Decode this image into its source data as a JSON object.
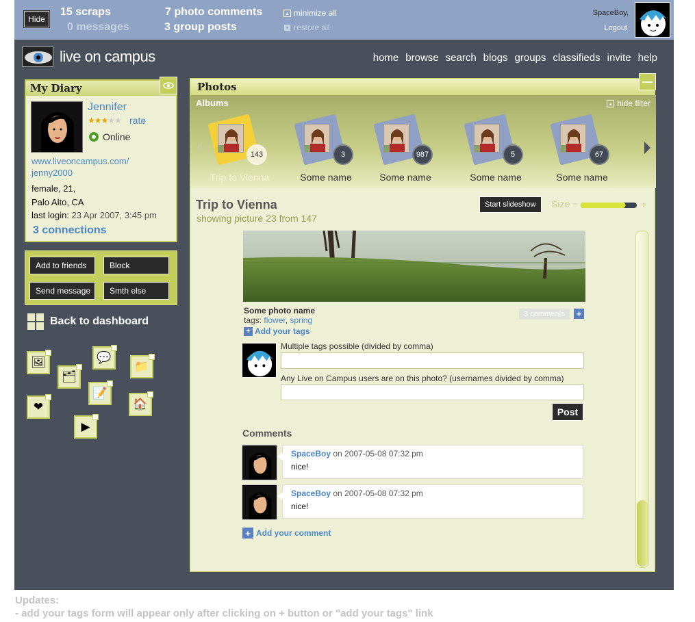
{
  "topbar": {
    "hide_label": "Hide",
    "scraps": "15 scraps",
    "messages": "0 messages",
    "photo_comments": "7 photo comments",
    "group_posts": "3 group posts",
    "minimize_all": "minimize all",
    "restore_all": "restore all",
    "user_name": "SpaceBoy,",
    "logout": "Logout"
  },
  "brand": {
    "logo_text": "live on campus"
  },
  "nav": [
    "home",
    "browse",
    "search",
    "blogs",
    "groups",
    "classifieds",
    "invite",
    "help"
  ],
  "diary": {
    "title": "My Diary",
    "name": "Jennifer",
    "stars_on": "★★★",
    "stars_off": "★★",
    "rating": 3,
    "rate_label": "rate",
    "status": "Online",
    "url_line1": "www.liveoncampus.com/",
    "url_line2": "jenny2000",
    "gender_age": "female, 21,",
    "location": "Palo Alto, CA",
    "last_login_label": "last login:",
    "last_login_value": "23 Apr 2007, 3:45 pm",
    "connections": "3 connections"
  },
  "actions": {
    "add_friends": "Add to friends",
    "block": "Block",
    "send_message": "Send message",
    "something_else": "Smth else"
  },
  "back_to_dashboard": "Back to dashboard",
  "app_icons": [
    "photo-frame-icon",
    "chat-bubbles-icon",
    "folder-icon",
    "photo-album-icon",
    "notepad-icon",
    "heart-icon",
    "house-icon",
    "media-play-icon"
  ],
  "photos": {
    "title": "Photos",
    "albums_label": "Albums",
    "hide_filter": "hide filter",
    "albums": [
      {
        "name": "Trip to Vienna",
        "count": "143",
        "selected": true
      },
      {
        "name": "Some name",
        "count": "3",
        "selected": false
      },
      {
        "name": "Some name",
        "count": "987",
        "selected": false
      },
      {
        "name": "Some name",
        "count": "5",
        "selected": false
      },
      {
        "name": "Some name",
        "count": "67",
        "selected": false
      }
    ],
    "album_title": "Trip to Vienna",
    "showing": "showing picture 23 from 147",
    "slideshow_label": "Start slideshow",
    "size_label": "Size",
    "size_minus": "−",
    "size_plus": "+",
    "size_level": 0.8,
    "photo_name": "Some photo name",
    "tags_label": "tags:",
    "tags": [
      "flower",
      "spring"
    ],
    "tag_sep": ",",
    "comments_badge": "3 comments",
    "add_tags": "Add your tags",
    "tags_field_label": "Multiple tags possible (divided by comma)",
    "users_field_label": "Any Live on Campus users are on this photo? (usernames divided by comma)",
    "post_label": "Post",
    "comments_heading": "Comments",
    "comments": [
      {
        "author": "SpaceBoy",
        "meta": " on 2007-05-08 07:32 pm",
        "text": "nice!"
      },
      {
        "author": "SpaceBoy",
        "meta": " on 2007-05-08 07:32 pm",
        "text": "nice!"
      }
    ],
    "add_comment": "Add your comment"
  },
  "updates": {
    "line1": "Updates:",
    "line2": "- add your tags form will appear only after clicking on + button or \"add your tags\" link"
  },
  "colors": {
    "frame": "#4a505b",
    "topbar": "#8fa4c4",
    "accent_green": "#c3cf5a",
    "panel_bg": "#eef0d6",
    "link_blue": "#4a86c8"
  }
}
